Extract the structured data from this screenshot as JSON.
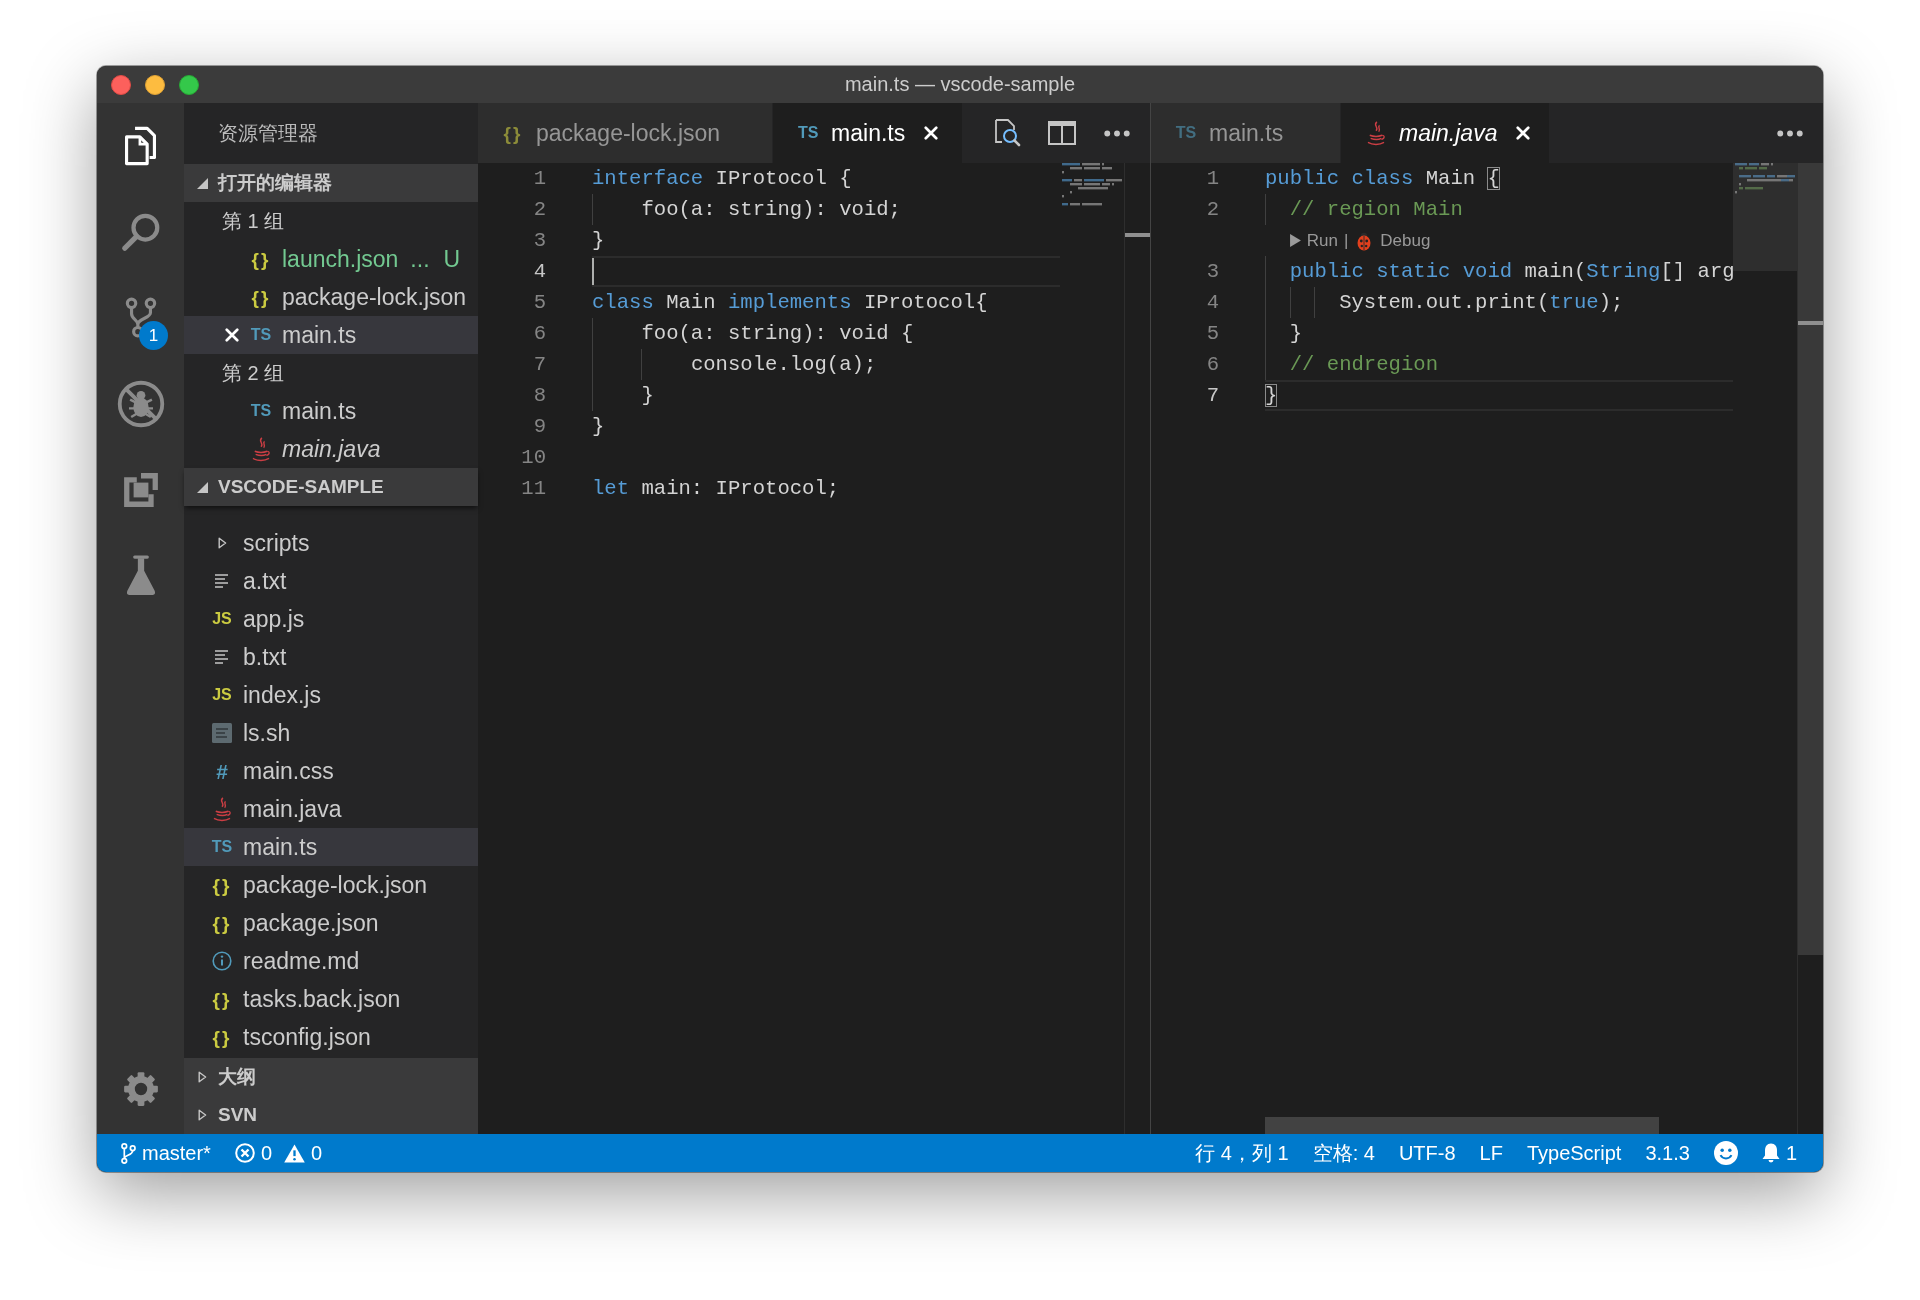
{
  "window": {
    "title": "main.ts — vscode-sample"
  },
  "activity_bar": {
    "items": [
      {
        "kind": "explorer",
        "selected": true
      },
      {
        "kind": "search",
        "selected": false
      },
      {
        "kind": "source-control",
        "selected": false,
        "badge": "1"
      },
      {
        "kind": "debug",
        "selected": false
      },
      {
        "kind": "extensions",
        "selected": false
      },
      {
        "kind": "test",
        "selected": false
      }
    ],
    "bottom_items": [
      {
        "kind": "settings",
        "selected": false
      }
    ]
  },
  "sidebar": {
    "title": "资源管理器",
    "sections": [
      {
        "title": "打开的编辑器",
        "expanded": true,
        "groups": [
          {
            "label": "第 1 组",
            "items": [
              {
                "name": "launch.json",
                "kind": "json",
                "icon": "{}",
                "description": "...",
                "decoration": "U",
                "untracked": true,
                "selected": false,
                "preview": false
              },
              {
                "name": "package-lock.json",
                "kind": "json",
                "icon": "{}",
                "untracked": false,
                "selected": false,
                "preview": false
              },
              {
                "name": "main.ts",
                "kind": "ts",
                "icon": "TS",
                "untracked": false,
                "selected": true,
                "preview": false
              }
            ]
          },
          {
            "label": "第 2 组",
            "items": [
              {
                "name": "main.ts",
                "kind": "ts",
                "icon": "TS",
                "untracked": false,
                "selected": false,
                "preview": false
              },
              {
                "name": "main.java",
                "kind": "java",
                "untracked": false,
                "selected": false,
                "preview": true
              }
            ]
          }
        ]
      },
      {
        "title": "VSCODE-SAMPLE",
        "expanded": true,
        "items": [
          {
            "name": "scripts",
            "kind": "folder",
            "expanded": false,
            "selected": false
          },
          {
            "name": "a.txt",
            "kind": "text",
            "selected": false
          },
          {
            "name": "app.js",
            "kind": "js",
            "icon": "JS",
            "selected": false
          },
          {
            "name": "b.txt",
            "kind": "text",
            "selected": false
          },
          {
            "name": "index.js",
            "kind": "js",
            "icon": "JS",
            "selected": false
          },
          {
            "name": "ls.sh",
            "kind": "shell",
            "selected": false
          },
          {
            "name": "main.css",
            "kind": "css",
            "icon": "#",
            "selected": false
          },
          {
            "name": "main.java",
            "kind": "java",
            "selected": false
          },
          {
            "name": "main.ts",
            "kind": "ts",
            "icon": "TS",
            "selected": true
          },
          {
            "name": "package-lock.json",
            "kind": "json",
            "icon": "{}",
            "selected": false
          },
          {
            "name": "package.json",
            "kind": "json",
            "icon": "{}",
            "selected": false
          },
          {
            "name": "readme.md",
            "kind": "info",
            "selected": false
          },
          {
            "name": "tasks.back.json",
            "kind": "json",
            "icon": "{}",
            "selected": false
          },
          {
            "name": "tsconfig.json",
            "kind": "json",
            "icon": "{}",
            "selected": false
          }
        ]
      },
      {
        "title": "大纲",
        "expanded": false
      },
      {
        "title": "SVN",
        "expanded": false
      }
    ]
  },
  "editors": [
    {
      "focused": true,
      "hovered": false,
      "tabs": [
        {
          "label": "package-lock.json",
          "kind": "json",
          "icon": "{}",
          "selected": false,
          "preview": false
        },
        {
          "label": "main.ts",
          "kind": "ts",
          "icon": "TS",
          "selected": true,
          "preview": false
        }
      ],
      "actions": [
        {
          "kind": "open-preview"
        },
        {
          "kind": "split"
        },
        {
          "kind": "more"
        }
      ],
      "lines": [
        {
          "kind": "code",
          "number": "1",
          "current": false,
          "tokens": [
            {
              "kind": "keyword",
              "text": "interface"
            },
            {
              "kind": "plain",
              "text": " IProtocol {"
            }
          ]
        },
        {
          "kind": "code",
          "number": "2",
          "current": false,
          "tokens": [
            {
              "kind": "plain",
              "text": "    foo(a: string): void;"
            }
          ]
        },
        {
          "kind": "code",
          "number": "3",
          "current": false,
          "tokens": [
            {
              "kind": "plain",
              "text": "}"
            }
          ]
        },
        {
          "kind": "code",
          "number": "4",
          "current": true
        },
        {
          "kind": "code",
          "number": "5",
          "current": false,
          "tokens": [
            {
              "kind": "keyword",
              "text": "class"
            },
            {
              "kind": "plain",
              "text": " Main "
            },
            {
              "kind": "keyword",
              "text": "implements"
            },
            {
              "kind": "plain",
              "text": " IProtocol{"
            }
          ]
        },
        {
          "kind": "code",
          "number": "6",
          "current": false,
          "tokens": [
            {
              "kind": "plain",
              "text": "    foo(a: string): void {"
            }
          ]
        },
        {
          "kind": "code",
          "number": "7",
          "current": false,
          "tokens": [
            {
              "kind": "plain",
              "text": "        console.log(a);"
            }
          ]
        },
        {
          "kind": "code",
          "number": "8",
          "current": false,
          "tokens": [
            {
              "kind": "plain",
              "text": "    }"
            }
          ]
        },
        {
          "kind": "code",
          "number": "9",
          "current": false,
          "tokens": [
            {
              "kind": "plain",
              "text": "}"
            }
          ]
        },
        {
          "kind": "code",
          "number": "10",
          "current": false
        },
        {
          "kind": "code",
          "number": "11",
          "current": false,
          "tokens": [
            {
              "kind": "keyword",
              "text": "let"
            },
            {
              "kind": "plain",
              "text": " main: IProtocol;"
            }
          ]
        }
      ]
    },
    {
      "focused": false,
      "hovered": true,
      "tabs": [
        {
          "label": "main.ts",
          "kind": "ts",
          "icon": "TS",
          "selected": false,
          "preview": false
        },
        {
          "label": "main.java",
          "kind": "java",
          "selected": true,
          "preview": true
        }
      ],
      "actions": [
        {
          "kind": "more"
        }
      ],
      "lines": [
        {
          "kind": "code",
          "number": "1",
          "current": false,
          "tokens": [
            {
              "kind": "keyword",
              "text": "public class"
            },
            {
              "kind": "plain",
              "text": " Main "
            },
            {
              "kind": "bracket-match",
              "text": "{"
            }
          ]
        },
        {
          "kind": "code",
          "number": "2",
          "current": false,
          "tokens": [
            {
              "kind": "comment",
              "text": "  // region Main"
            }
          ]
        },
        {
          "kind": "codelens",
          "run": "Run",
          "separator": "|",
          "debug": "Debug"
        },
        {
          "kind": "code",
          "number": "3",
          "current": false,
          "tokens": [
            {
              "kind": "keyword",
              "text": "  public static void"
            },
            {
              "kind": "plain",
              "text": " main("
            },
            {
              "kind": "keyword",
              "text": "String"
            },
            {
              "kind": "plain",
              "text": "[] arg"
            }
          ]
        },
        {
          "kind": "code",
          "number": "4",
          "current": false,
          "tokens": [
            {
              "kind": "plain",
              "text": "      System.out.print("
            },
            {
              "kind": "keyword",
              "text": "true"
            },
            {
              "kind": "plain",
              "text": ");"
            }
          ]
        },
        {
          "kind": "code",
          "number": "5",
          "current": false,
          "tokens": [
            {
              "kind": "plain",
              "text": "  }"
            }
          ]
        },
        {
          "kind": "code",
          "number": "6",
          "current": false,
          "tokens": [
            {
              "kind": "comment",
              "text": "  // endregion"
            }
          ]
        },
        {
          "kind": "code",
          "number": "7",
          "current": true,
          "tokens": [
            {
              "kind": "bracket-match",
              "text": "}"
            }
          ]
        }
      ]
    }
  ],
  "status_bar": {
    "left": [
      {
        "kind": "branch",
        "text": "master*"
      },
      {
        "kind": "problems",
        "errors": "0",
        "warnings": "0"
      }
    ],
    "right": [
      {
        "kind": "position",
        "text": "行 4，列 1"
      },
      {
        "kind": "indentation",
        "text": "空格: 4"
      },
      {
        "kind": "encoding",
        "text": "UTF-8"
      },
      {
        "kind": "eol",
        "text": "LF"
      },
      {
        "kind": "language",
        "text": "TypeScript"
      },
      {
        "kind": "version",
        "text": "3.1.3"
      },
      {
        "kind": "feedback"
      },
      {
        "kind": "notifications",
        "text": "1"
      }
    ]
  }
}
